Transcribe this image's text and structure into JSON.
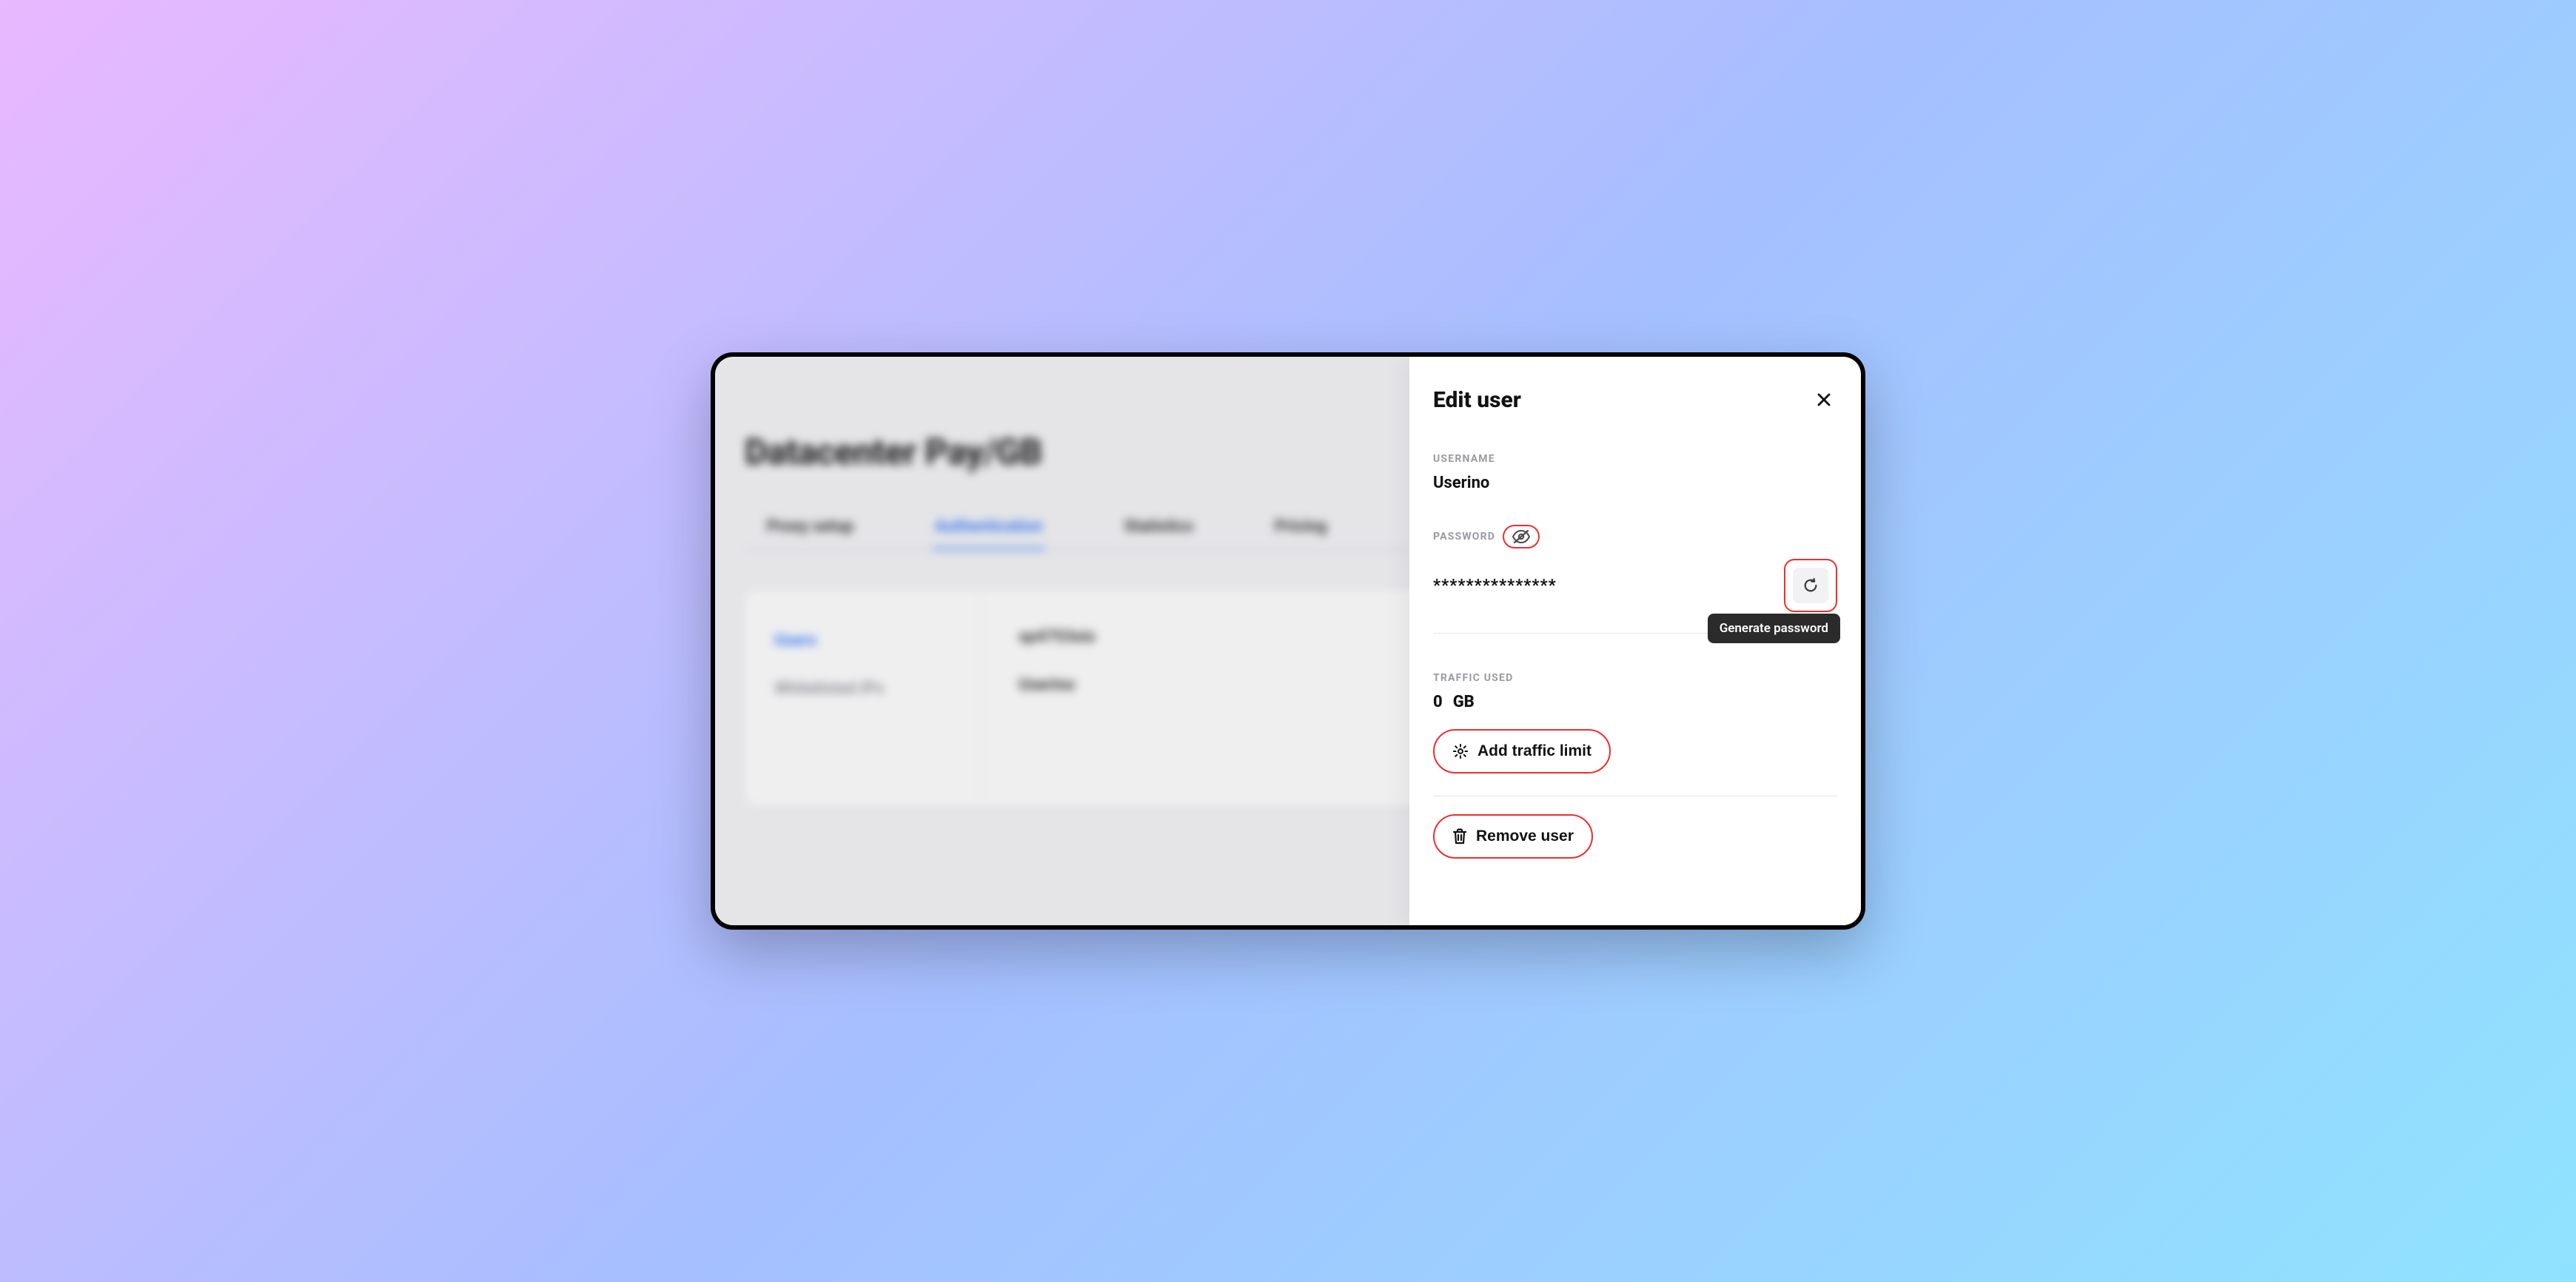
{
  "page": {
    "title": "Datacenter Pay/GB",
    "tabs": [
      "Proxy setup",
      "Authentication",
      "Statistics",
      "Pricing"
    ],
    "active_tab_index": 1,
    "side": {
      "items": [
        "Users",
        "Whitelisted IPs"
      ],
      "active_index": 0
    },
    "users": [
      "sp4753sio",
      "Userino"
    ]
  },
  "drawer": {
    "title": "Edit user",
    "username_label": "USERNAME",
    "username_value": "Userino",
    "password_label": "PASSWORD",
    "password_masked": "***************",
    "regen_tooltip": "Generate password",
    "traffic_label": "TRAFFIC USED",
    "traffic_value": "0",
    "traffic_unit": "GB",
    "add_traffic_label": "Add traffic limit",
    "remove_user_label": "Remove user"
  }
}
